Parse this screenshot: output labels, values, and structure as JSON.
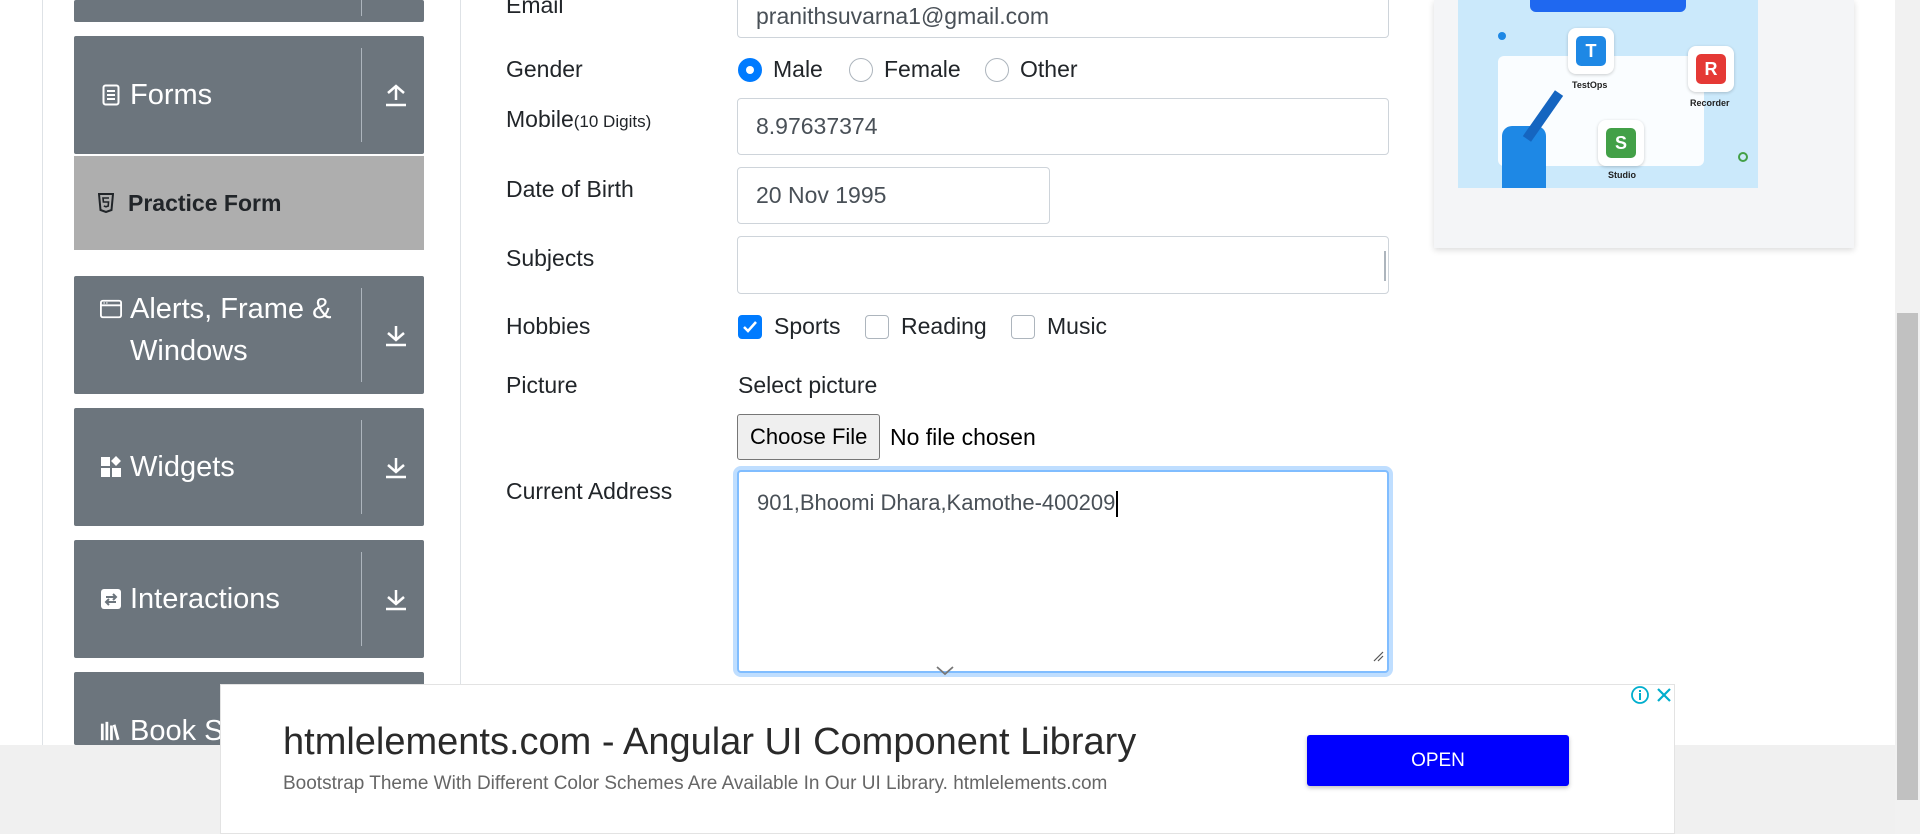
{
  "sidebar": {
    "groups": [
      {
        "label": "Forms",
        "icon": "form-document-icon",
        "arrow": "up"
      },
      {
        "label": "Alerts, Frame &",
        "label_line2": "Windows",
        "icon": "browser-window-icon",
        "arrow": "down"
      },
      {
        "label": "Widgets",
        "icon": "widgets-icon",
        "arrow": "down"
      },
      {
        "label": "Interactions",
        "icon": "interactions-icon",
        "arrow": "down"
      },
      {
        "label": "Book S",
        "icon": "books-icon",
        "arrow": "down"
      }
    ],
    "active_item": {
      "label": "Practice Form",
      "icon": "html5-icon"
    }
  },
  "form": {
    "email": {
      "label": "Email",
      "value": "pranithsuvarna1@gmail.com"
    },
    "gender": {
      "label": "Gender",
      "options": [
        "Male",
        "Female",
        "Other"
      ],
      "selected": "Male"
    },
    "mobile": {
      "label": "Mobile",
      "hint": "(10 Digits)",
      "value": "8.97637374"
    },
    "dob": {
      "label": "Date of Birth",
      "value": "20 Nov 1995"
    },
    "subjects": {
      "label": "Subjects",
      "value": ""
    },
    "hobbies": {
      "label": "Hobbies",
      "options": [
        "Sports",
        "Reading",
        "Music"
      ],
      "checked": [
        "Sports"
      ]
    },
    "picture": {
      "label": "Picture",
      "select_text": "Select picture",
      "button": "Choose File",
      "status": "No file chosen"
    },
    "address": {
      "label": "Current Address",
      "value": "901,Bhoomi Dhara,Kamothe-400209"
    }
  },
  "side_ad": {
    "labels": [
      "TestOps",
      "Recorder",
      "Studio"
    ]
  },
  "banner_ad": {
    "title": "htmlelements.com - Angular UI Component Library",
    "description": "Bootstrap Theme With Different Color Schemes Are Available In Our UI Library. htmlelements.com",
    "button": "OPEN"
  },
  "colors": {
    "sidebar": "#6c757d",
    "active": "#aeaeae",
    "accent": "#007bff",
    "ad_button": "#0000ff"
  }
}
